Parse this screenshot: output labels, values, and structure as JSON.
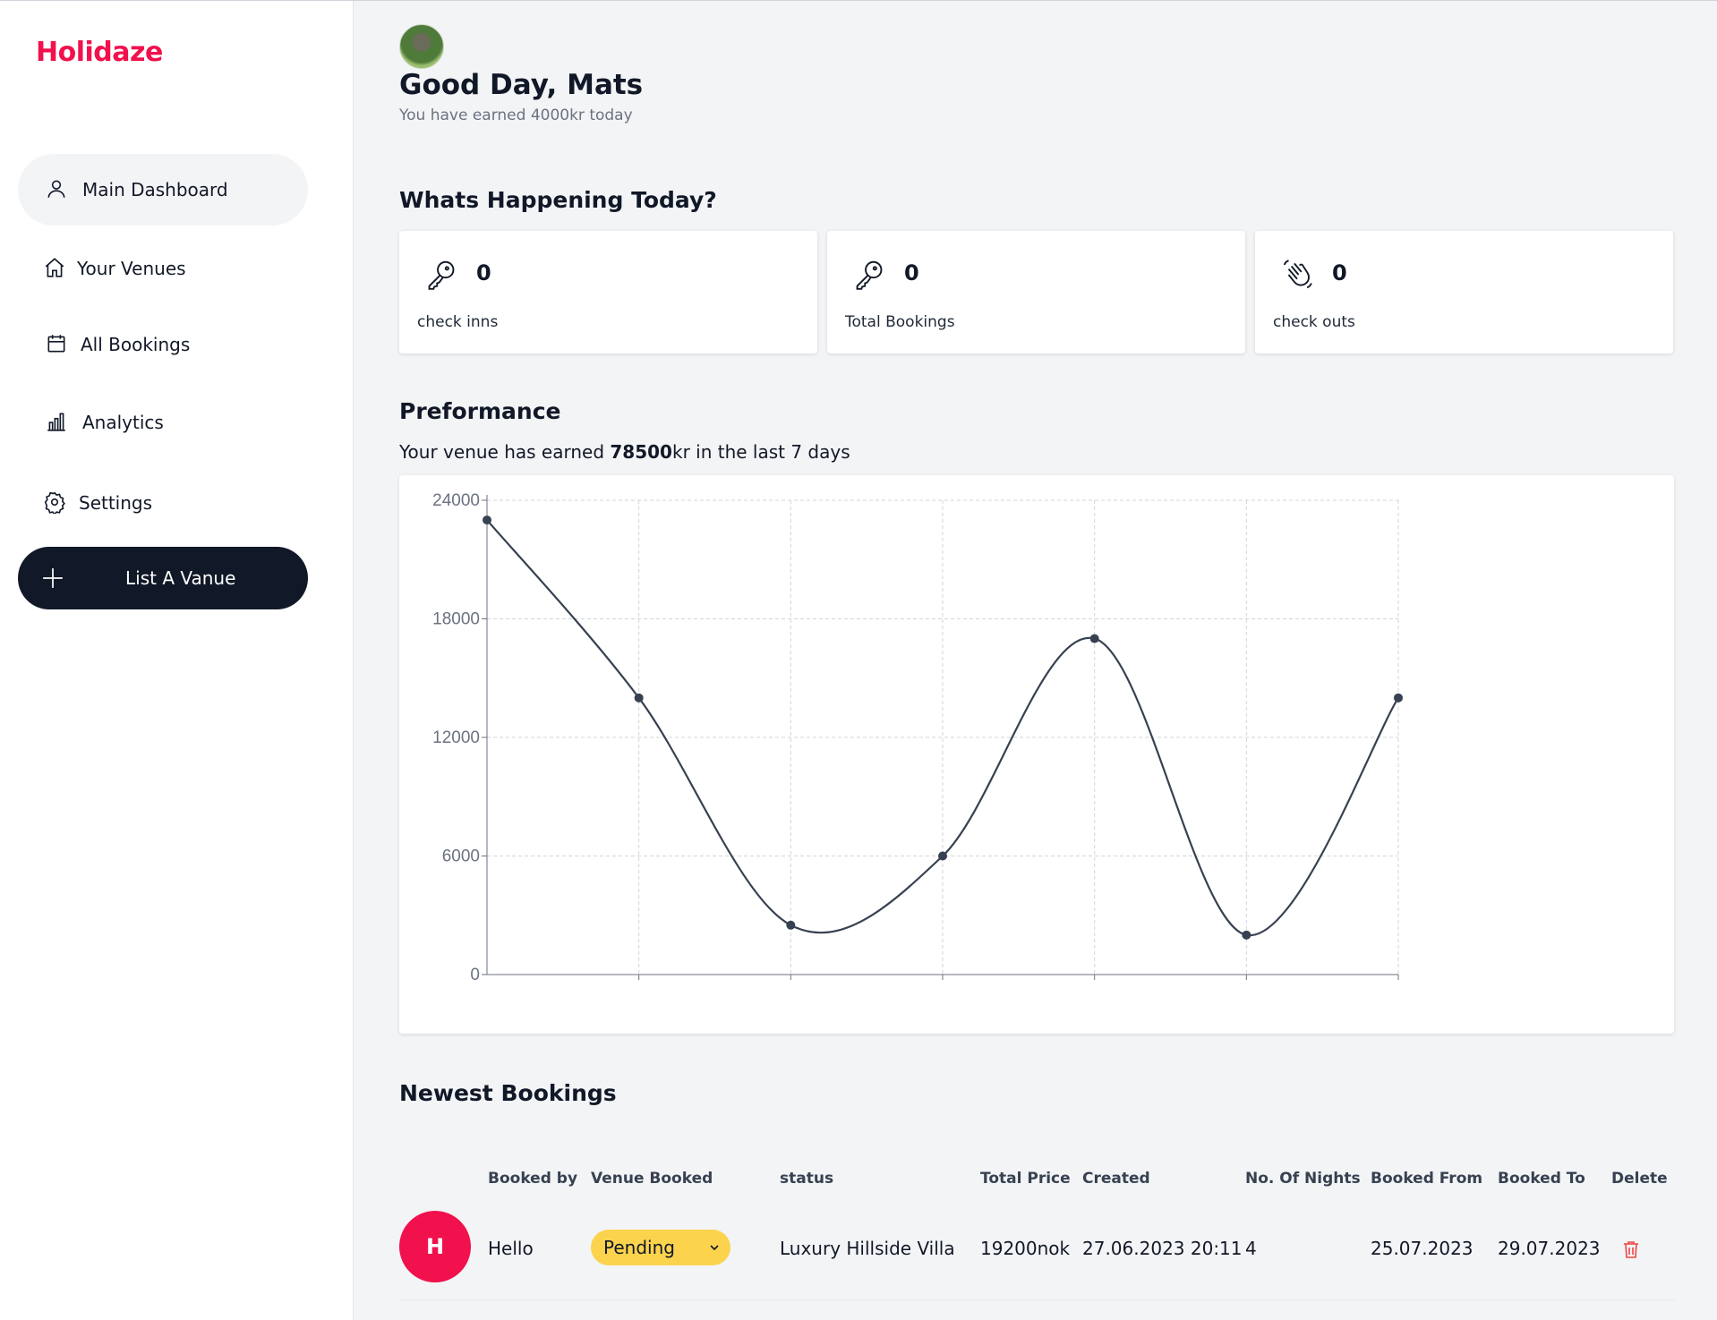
{
  "brand": {
    "name": "Holidaze",
    "color": "#f0114d"
  },
  "sidebar": {
    "items": [
      {
        "label": "Main Dashboard",
        "icon": "user-icon",
        "active": true
      },
      {
        "label": "Your Venues",
        "icon": "home-icon",
        "active": false
      },
      {
        "label": "All Bookings",
        "icon": "calendar-icon",
        "active": false
      },
      {
        "label": "Analytics",
        "icon": "bar-chart-icon",
        "active": false
      },
      {
        "label": "Settings",
        "icon": "gear-icon",
        "active": false
      }
    ],
    "cta": {
      "label": "List A Vanue",
      "icon": "plus-icon"
    }
  },
  "header": {
    "greeting": "Good Day, Mats",
    "subtitle": "You have earned 4000kr today"
  },
  "today": {
    "title": "Whats Happening Today?",
    "cards": [
      {
        "value": "0",
        "label": "check inns",
        "icon": "key-icon"
      },
      {
        "value": "0",
        "label": "Total Bookings",
        "icon": "key-icon"
      },
      {
        "value": "0",
        "label": "check outs",
        "icon": "waving-hand-icon"
      }
    ]
  },
  "performance": {
    "title": "Preformance",
    "summary_prefix": "Your venue has earned ",
    "summary_amount": "78500",
    "summary_suffix": "kr in the last 7 days"
  },
  "chart_data": {
    "type": "line",
    "x": [
      1,
      2,
      3,
      4,
      5,
      6,
      7
    ],
    "series": [
      {
        "values": [
          23000,
          14000,
          2500,
          6000,
          17000,
          2000,
          14000
        ]
      }
    ],
    "yticks": [
      0,
      6000,
      12000,
      18000,
      24000
    ],
    "ylim": [
      0,
      24000
    ],
    "xlabel": "",
    "ylabel": "",
    "grid": true,
    "line_color": "#374151"
  },
  "bookings": {
    "title": "Newest Bookings",
    "columns": [
      "Booked by",
      "Venue Booked",
      "status",
      "Total Price",
      "Created",
      "No. Of Nights",
      "Booked From",
      "Booked To",
      "Delete"
    ],
    "rows": [
      {
        "initial": "H",
        "booked_by": "Hello",
        "status": "Pending",
        "venue": "Luxury Hillside Villa",
        "total_price": "19200nok",
        "created": "27.06.2023 20:11",
        "nights": "4",
        "from": "25.07.2023",
        "to": "29.07.2023"
      }
    ]
  }
}
